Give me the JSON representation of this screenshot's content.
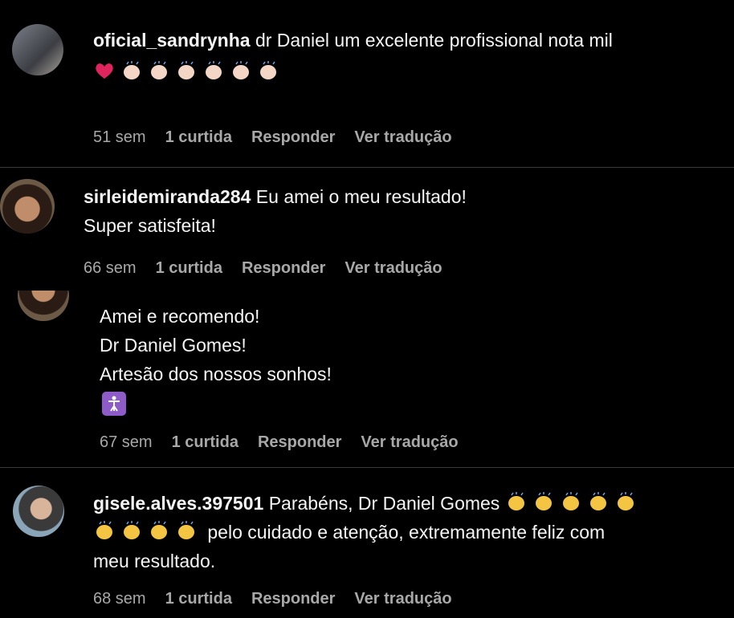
{
  "comments": [
    {
      "username": "oficial_sandrynha",
      "text": "dr Daniel um excelente profissional nota mil",
      "emoji_line": "❤️👏🏻👏🏻👏🏻👏🏻👏🏻👏🏻.",
      "time": "51 sem",
      "likes": "1 curtida",
      "reply": "Responder",
      "translate": "Ver tradução"
    },
    {
      "username": "sirleidemiranda284",
      "text_line1": "Eu amei o meu resultado!",
      "text_line2": "Super satisfeita!",
      "time": "66 sem",
      "likes": "1 curtida",
      "reply": "Responder",
      "translate": "Ver tradução"
    },
    {
      "line1": "Amei e recomendo!",
      "line2": "Dr Daniel Gomes!",
      "line3": "Artesão dos nossos sonhos!",
      "time": "67 sem",
      "likes": "1 curtida",
      "reply": "Responder",
      "translate": "Ver tradução"
    },
    {
      "username": "gisele.alves.397501",
      "text_line1": "Parabéns, Dr Daniel Gomes",
      "text_line2": "pelo cuidado e atenção, extremamente feliz com",
      "text_line3": "meu resultado.",
      "time": "68 sem",
      "likes": "1 curtida",
      "reply": "Responder",
      "translate": "Ver tradução"
    }
  ],
  "colors": {
    "background": "#000000",
    "meta": "#a8a8a8",
    "heart": "#e0245e",
    "clap": "#f4c542",
    "clap_light": "#f3d6c6",
    "badge": "#8e5cc9"
  },
  "icons": [
    "heart-icon",
    "clap-light-icon",
    "clap-icon",
    "accessibility-badge-icon"
  ]
}
